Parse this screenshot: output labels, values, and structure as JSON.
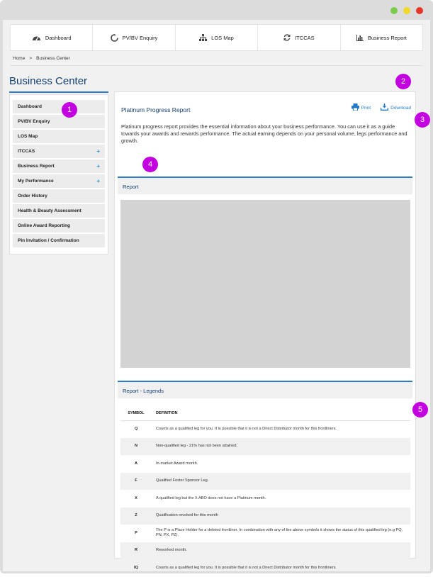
{
  "window": {
    "dot_colors": [
      "#7ccb4f",
      "#f2d82a",
      "#e4362a"
    ]
  },
  "topnav": [
    {
      "label": "Dashboard",
      "icon": "speedometer-icon"
    },
    {
      "label": "PV/BV Enquiry",
      "icon": "refresh-circle-icon"
    },
    {
      "label": "LOS Map",
      "icon": "org-chart-icon"
    },
    {
      "label": "ITCCAS",
      "icon": "sync-arrows-icon"
    },
    {
      "label": "Business Report",
      "icon": "bar-chart-icon"
    }
  ],
  "breadcrumb": {
    "home": "Home",
    "separator": ">",
    "current": "Business Center"
  },
  "page_title": "Business Center",
  "sidebar": [
    {
      "label": "Dashboard",
      "plus": ""
    },
    {
      "label": "PV/BV Enquiry",
      "plus": ""
    },
    {
      "label": "LOS Map",
      "plus": ""
    },
    {
      "label": "ITCCAS",
      "plus": "+"
    },
    {
      "label": "Business Report",
      "plus": "+"
    },
    {
      "label": "My Performance",
      "plus": "+"
    },
    {
      "label": "Order History",
      "plus": ""
    },
    {
      "label": "Health & Beauty Assessment",
      "plus": ""
    },
    {
      "label": "Online Award Reporting",
      "plus": ""
    },
    {
      "label": "Pin Invitation / Confirmation",
      "plus": ""
    }
  ],
  "content": {
    "title": "Platinum Progress Report",
    "print_label": "Print",
    "download_label": "Download",
    "description": "Platinum progress report provides the essential information about your business performance. You can use it as a guide towards your awards and rewards performance. The actual earning depends on your personal volume, legs performance and growth.",
    "report_section": "Report",
    "legends_section": "Report - Legends",
    "legend_headers": {
      "symbol": "SYMBOL",
      "definition": "DEFINITION"
    },
    "legends": [
      {
        "symbol": "Q",
        "definition": "Counts as a qualified leg for you. It is possible that it is not a Direct Distributor month for this frontliners."
      },
      {
        "symbol": "N",
        "definition": "Non-qualified leg - 21% has not been attained."
      },
      {
        "symbol": "A",
        "definition": "In-market Award month."
      },
      {
        "symbol": "F",
        "definition": "Qualified Foster Sponsor Leg."
      },
      {
        "symbol": "X",
        "definition": "A qualified leg but the X ABO does not have a Platinum month."
      },
      {
        "symbol": "Z",
        "definition": "Qualification revoked for this month"
      },
      {
        "symbol": "P",
        "definition": "The P is a Place Holder for a deleted frontliner. In combination with any of the above symbols it shows the status of this qualified leg (e.g PQ, PN, PX, PZ)."
      },
      {
        "symbol": "R",
        "definition": "Reworked month."
      },
      {
        "symbol": "IQ",
        "definition": "Counts as a qualified leg for you. It is possible that it is not a Direct Distributor month for this frontliners."
      }
    ]
  },
  "markers": [
    "1",
    "2",
    "3",
    "4",
    "5"
  ],
  "colors": {
    "accent": "#2f7cc2",
    "title": "#123f72",
    "marker": "#c200e0",
    "link": "#2479c7"
  }
}
